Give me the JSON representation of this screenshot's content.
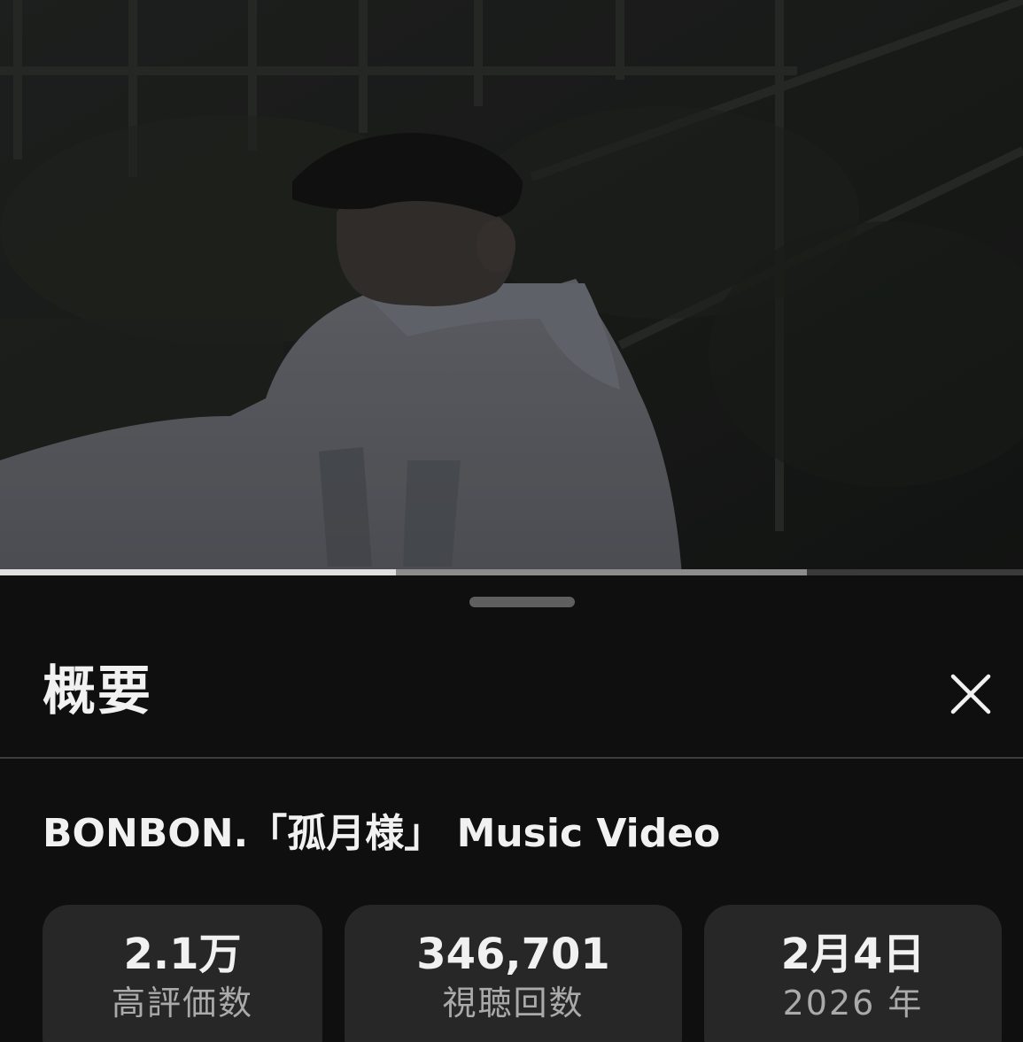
{
  "player": {
    "progress_played": 0.387,
    "progress_buffered": 0.789
  },
  "sheet": {
    "title": "概要",
    "close_icon": "close-icon",
    "video_title": "BONBON.「孤月様」 Music Video",
    "stats": {
      "likes": {
        "value": "2.1万",
        "label": "高評価数"
      },
      "views": {
        "value": "346,701",
        "label": "視聴回数"
      },
      "date": {
        "value": "2月4日",
        "label": "2026 年"
      }
    }
  },
  "colors": {
    "background": "#0f0f0f",
    "card": "#272727",
    "text_primary": "#f1f1f1",
    "text_secondary": "#aaaaaa"
  }
}
